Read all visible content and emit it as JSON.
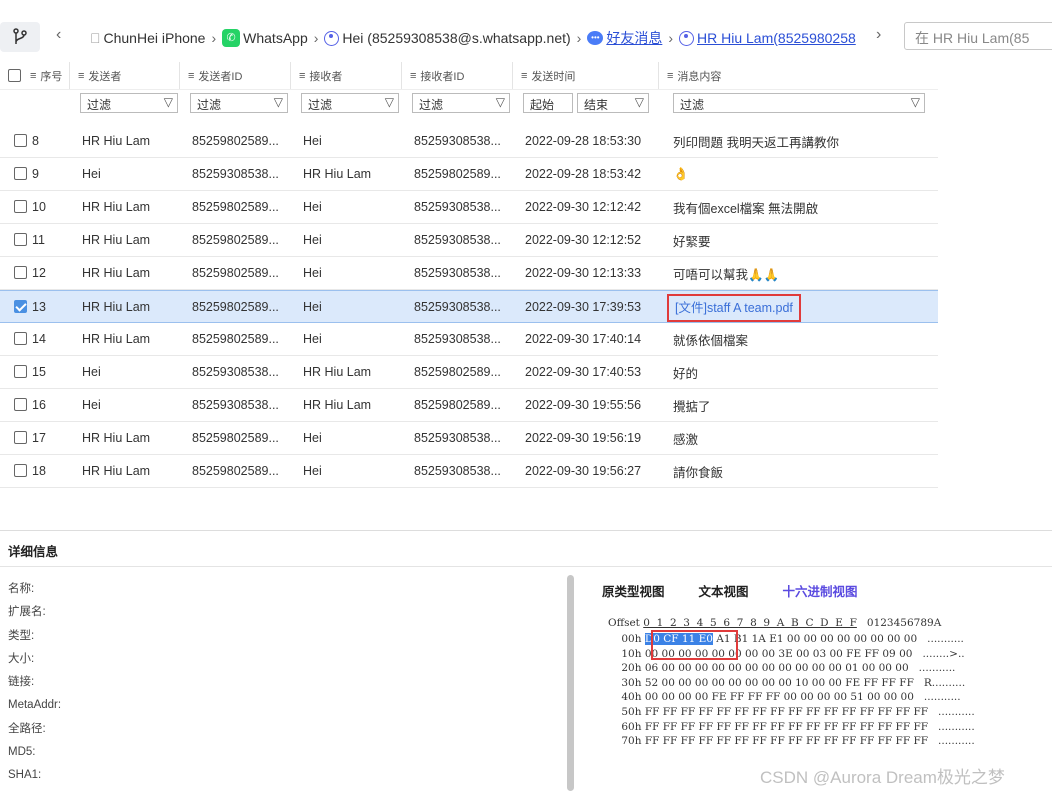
{
  "breadcrumb": {
    "device": "ChunHei iPhone",
    "app": "WhatsApp",
    "account": "Hei  (85259308538@s.whatsapp.net)",
    "category": "好友消息",
    "contact": "HR Hiu Lam(8525980258"
  },
  "search": {
    "placeholder": "在 HR Hiu Lam(85"
  },
  "columns": [
    "序号",
    "发送者",
    "发送者ID",
    "接收者",
    "接收者ID",
    "发送时间",
    "消息内容"
  ],
  "filters": {
    "filter_label": "过滤",
    "start_label": "起始",
    "end_label": "结束"
  },
  "rows": [
    {
      "no": "8",
      "sender": "HR Hiu Lam",
      "sender_id": "85259802589...",
      "receiver": "Hei",
      "receiver_id": "85259308538...",
      "time": "2022-09-28 18:53:30",
      "content": "列印問題 我明天返工再講教你",
      "checked": false
    },
    {
      "no": "9",
      "sender": "Hei",
      "sender_id": "85259308538...",
      "receiver": "HR Hiu Lam",
      "receiver_id": "85259802589...",
      "time": "2022-09-28 18:53:42",
      "content": "👌",
      "checked": false
    },
    {
      "no": "10",
      "sender": "HR Hiu Lam",
      "sender_id": "85259802589...",
      "receiver": "Hei",
      "receiver_id": "85259308538...",
      "time": "2022-09-30 12:12:42",
      "content": "我有個excel檔案 無法開啟",
      "checked": false
    },
    {
      "no": "11",
      "sender": "HR Hiu Lam",
      "sender_id": "85259802589...",
      "receiver": "Hei",
      "receiver_id": "85259308538...",
      "time": "2022-09-30 12:12:52",
      "content": "好緊要",
      "checked": false
    },
    {
      "no": "12",
      "sender": "HR Hiu Lam",
      "sender_id": "85259802589...",
      "receiver": "Hei",
      "receiver_id": "85259308538...",
      "time": "2022-09-30 12:13:33",
      "content": "可唔可以幫我🙏🙏",
      "checked": false
    },
    {
      "no": "13",
      "sender": "HR Hiu Lam",
      "sender_id": "85259802589...",
      "receiver": "Hei",
      "receiver_id": "85259308538...",
      "time": "2022-09-30 17:39:53",
      "content": "[文件]staff A team.pdf",
      "checked": true
    },
    {
      "no": "14",
      "sender": "HR Hiu Lam",
      "sender_id": "85259802589...",
      "receiver": "Hei",
      "receiver_id": "85259308538...",
      "time": "2022-09-30 17:40:14",
      "content": "就係依個檔案",
      "checked": false
    },
    {
      "no": "15",
      "sender": "Hei",
      "sender_id": "85259308538...",
      "receiver": "HR Hiu Lam",
      "receiver_id": "85259802589...",
      "time": "2022-09-30 17:40:53",
      "content": "好的",
      "checked": false
    },
    {
      "no": "16",
      "sender": "Hei",
      "sender_id": "85259308538...",
      "receiver": "HR Hiu Lam",
      "receiver_id": "85259802589...",
      "time": "2022-09-30 19:55:56",
      "content": "攪掂了",
      "checked": false
    },
    {
      "no": "17",
      "sender": "HR Hiu Lam",
      "sender_id": "85259802589...",
      "receiver": "Hei",
      "receiver_id": "85259308538...",
      "time": "2022-09-30 19:56:19",
      "content": "感激",
      "checked": false
    },
    {
      "no": "18",
      "sender": "HR Hiu Lam",
      "sender_id": "85259802589...",
      "receiver": "Hei",
      "receiver_id": "85259308538...",
      "time": "2022-09-30 19:56:27",
      "content": "請你食飯",
      "checked": false
    }
  ],
  "detail": {
    "title": "详细信息",
    "props": [
      "名称:",
      "扩展名:",
      "类型:",
      "大小:",
      "链接:",
      "MetaAddr:",
      "全路径:",
      "MD5:",
      "SHA1:"
    ],
    "tabs": [
      "原类型视图",
      "文本视图",
      "十六进制视图"
    ],
    "hex_header_offset": "Offset",
    "hex_header_cols": "0  1  2  3  4  5  6  7  8  9  A  B  C  D  E  F",
    "hex_header_ascii": "0123456789A",
    "hex_lines": [
      {
        "off": "00h",
        "hi": "D0 CF 11 E0",
        "rest": " A1 B1 1A E1 00 00 00 00 00 00 00 00",
        "ascii": "..........."
      },
      {
        "off": "10h",
        "hi": "",
        "rest": "00 00 00 00 00 00 00 00 3E 00 03 00 FE FF 09 00",
        "ascii": "........>.."
      },
      {
        "off": "20h",
        "hi": "",
        "rest": "06 00 00 00 00 00 00 00 00 00 00 00 01 00 00 00",
        "ascii": "..........."
      },
      {
        "off": "30h",
        "hi": "",
        "rest": "52 00 00 00 00 00 00 00 00 10 00 00 FE FF FF FF",
        "ascii": "R.........."
      },
      {
        "off": "40h",
        "hi": "",
        "rest": "00 00 00 00 FE FF FF FF 00 00 00 00 51 00 00 00",
        "ascii": "..........."
      },
      {
        "off": "50h",
        "hi": "",
        "rest": "FF FF FF FF FF FF FF FF FF FF FF FF FF FF FF FF",
        "ascii": "..........."
      },
      {
        "off": "60h",
        "hi": "",
        "rest": "FF FF FF FF FF FF FF FF FF FF FF FF FF FF FF FF",
        "ascii": "..........."
      },
      {
        "off": "70h",
        "hi": "",
        "rest": "FF FF FF FF FF FF FF FF FF FF FF FF FF FF FF FF",
        "ascii": "..........."
      }
    ]
  },
  "watermark": "CSDN @Aurora Dream极光之梦"
}
